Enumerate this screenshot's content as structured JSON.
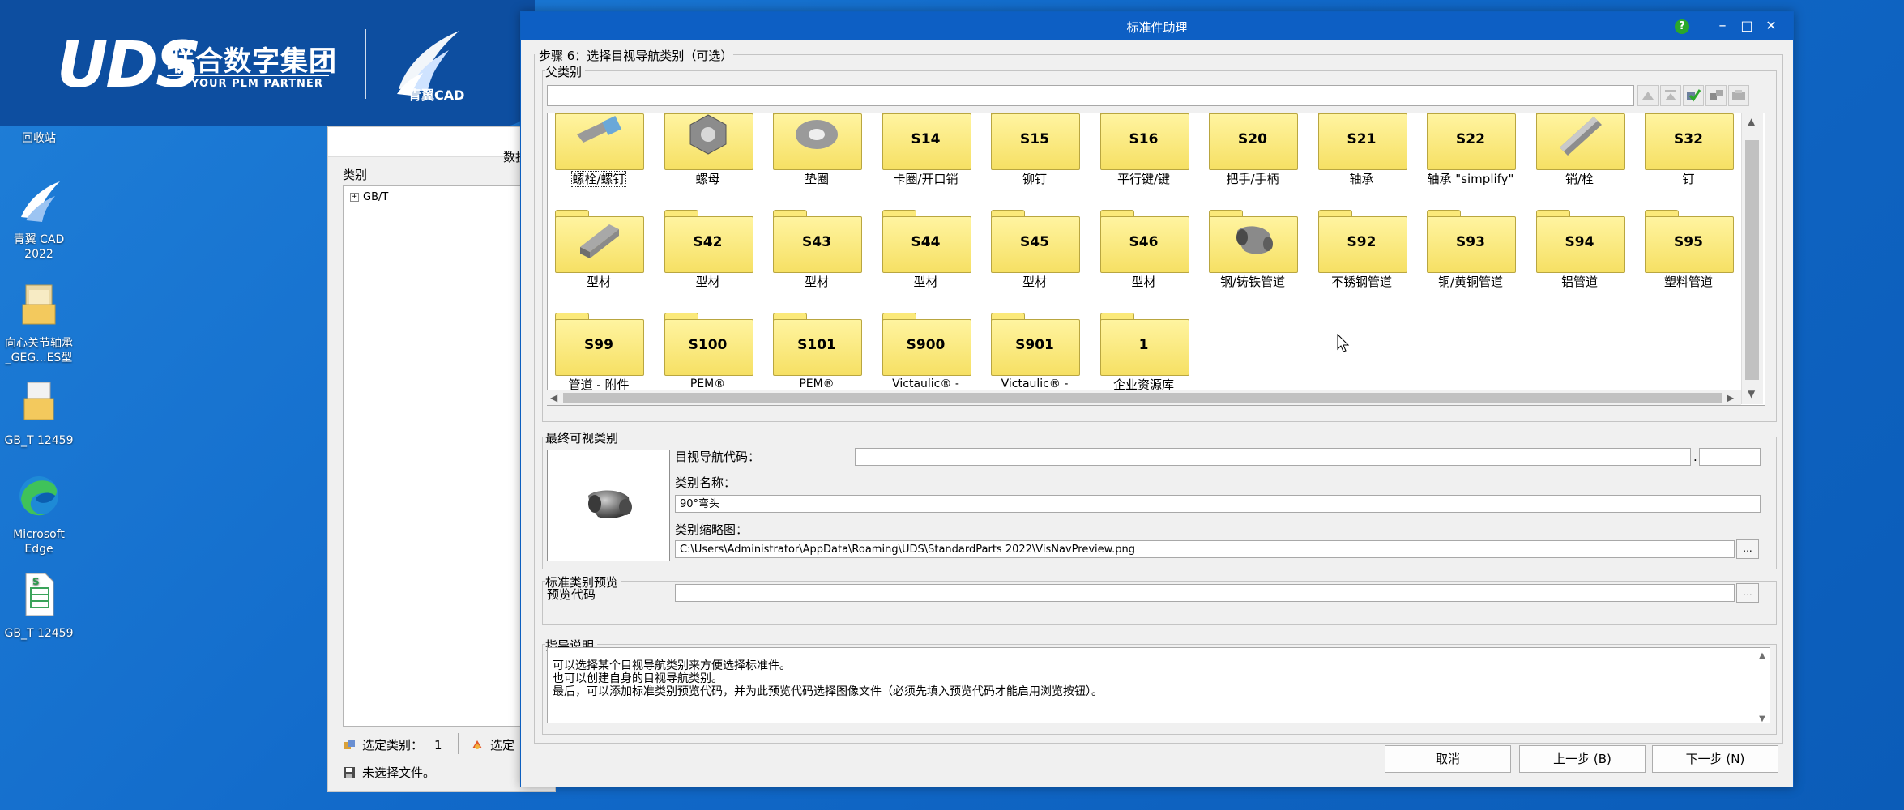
{
  "brand": {
    "logo": "UDS",
    "name": "联合数字集团",
    "slogan": "YOUR PLM PARTNER",
    "cad_logo": "青翼CAD"
  },
  "desktop": {
    "icons": [
      {
        "label": "回收站",
        "icon": "recycle-bin-icon"
      },
      {
        "label": "青翼 CAD 2022",
        "icon": "qingyi-cad-icon"
      },
      {
        "label": "向心关节轴承_GEG...ES型",
        "icon": "folder-icon"
      },
      {
        "label": "GB_T 12459",
        "icon": "folder-icon"
      },
      {
        "label": "Microsoft Edge",
        "icon": "edge-icon"
      },
      {
        "label": "GB_T 12459",
        "icon": "spreadsheet-icon"
      }
    ]
  },
  "bg_window": {
    "data_label": "数抄",
    "group_label": "类别",
    "tree_node": "GB/T",
    "tree_expander": "+",
    "status_selected_label": "选定类别：",
    "status_selected_value": "1",
    "status_selected2": "选定",
    "status_file": "未选择文件。"
  },
  "dialog": {
    "title": "标准件助理",
    "help": "?",
    "minimize": "–",
    "maximize": "□",
    "close": "✕",
    "step_legend": "步骤 6：选择目视导航类别（可选）",
    "parent_legend": "父类别",
    "parent_path": "",
    "categories": [
      {
        "code": "",
        "label": "螺栓/螺钉",
        "pic": "bolt"
      },
      {
        "code": "",
        "label": "螺母",
        "pic": "nut"
      },
      {
        "code": "",
        "label": "垫圈",
        "pic": "washer"
      },
      {
        "code": "S14",
        "label": "卡圈/开口销"
      },
      {
        "code": "S15",
        "label": "铆钉"
      },
      {
        "code": "S16",
        "label": "平行键/键"
      },
      {
        "code": "S20",
        "label": "把手/手柄"
      },
      {
        "code": "S21",
        "label": "轴承"
      },
      {
        "code": "S22",
        "label": "轴承 \"simplify\""
      },
      {
        "code": "",
        "label": "销/栓",
        "pic": "pin"
      },
      {
        "code": "S32",
        "label": "钉"
      },
      {
        "code": "",
        "label": "型材",
        "pic": "beam"
      },
      {
        "code": "S42",
        "label": "型材"
      },
      {
        "code": "S43",
        "label": "型材"
      },
      {
        "code": "S44",
        "label": "型材"
      },
      {
        "code": "S45",
        "label": "型材"
      },
      {
        "code": "S46",
        "label": "型材"
      },
      {
        "code": "",
        "label": "钢/铸铁管道",
        "pic": "elbow"
      },
      {
        "code": "S92",
        "label": "不锈钢管道"
      },
      {
        "code": "S93",
        "label": "铜/黄铜管道"
      },
      {
        "code": "S94",
        "label": "铝管道"
      },
      {
        "code": "S95",
        "label": "塑料管道"
      },
      {
        "code": "S99",
        "label": "管道 - 附件"
      },
      {
        "code": "S100",
        "label": "PEM® Fasteners - Inch"
      },
      {
        "code": "S101",
        "label": "PEM® Fasteners - mm"
      },
      {
        "code": "S900",
        "label": "Victaulic® - inch"
      },
      {
        "code": "S901",
        "label": "Victaulic® - mm"
      },
      {
        "code": "1",
        "label": "企业资源库"
      }
    ],
    "final_legend": "最终可视类别",
    "nav_code_label": "目视导航代码：",
    "nav_code_value": "",
    "nav_code_suffix": "",
    "cat_name_label": "类别名称：",
    "cat_name_value": "90°弯头",
    "thumb_label": "类别缩略图：",
    "thumb_path": "C:\\Users\\Administrator\\AppData\\Roaming\\UDS\\StandardParts 2022\\VisNavPreview.png",
    "browse": "...",
    "std_legend": "标准类别预览",
    "preview_code_label": "预览代码",
    "preview_code_value": "",
    "guide_legend": "指导说明",
    "guide_lines": [
      "可以选择某个目视导航类别来方便选择标准件。",
      "也可以创建自身的目视导航类别。",
      "最后，可以添加标准类别预览代码，并为此预览代码选择图像文件（必须先填入预览代码才能启用浏览按钮）。"
    ],
    "buttons": {
      "cancel": "取消",
      "back": "上一步 (B)",
      "next": "下一步 (N)"
    }
  },
  "colors": {
    "titlebar": "#0d5fc4",
    "brand": "#0d4ea0",
    "folder": "#f6e064",
    "desktop": "#1169c9"
  }
}
